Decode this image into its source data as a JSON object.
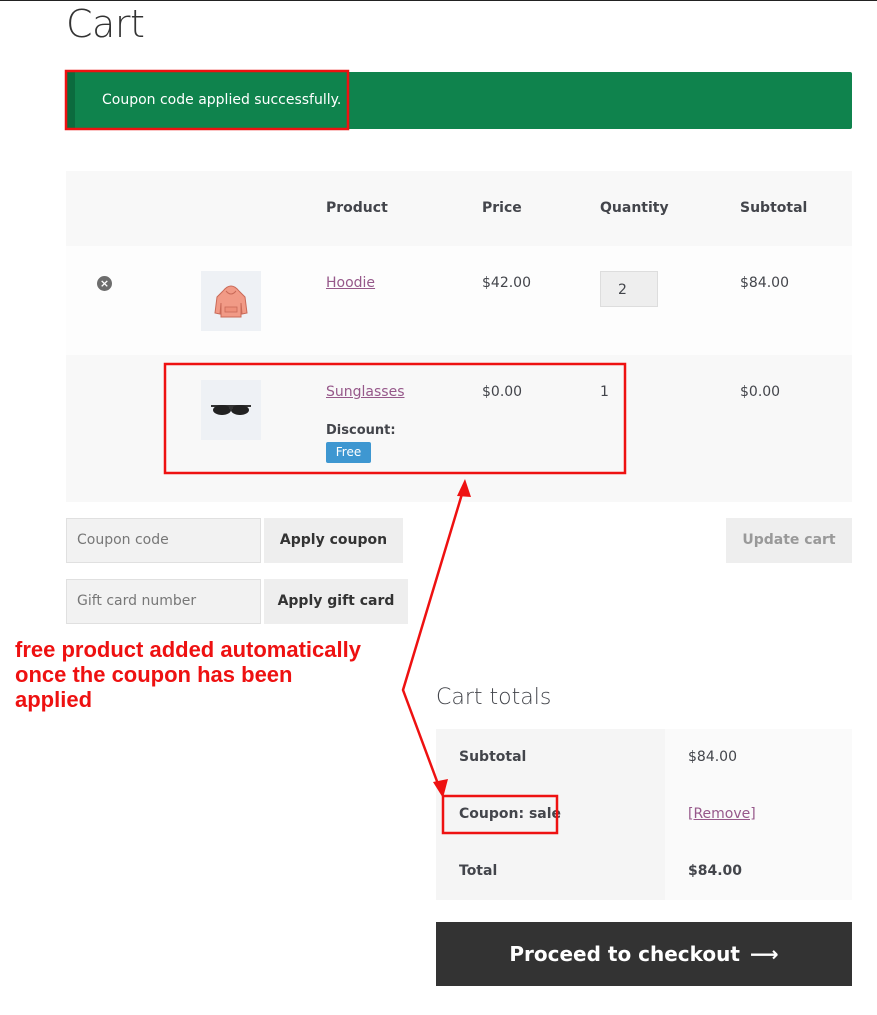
{
  "page_title": "Cart",
  "notice": {
    "text": "Coupon code applied successfully.",
    "color": "#0f834d"
  },
  "table": {
    "headers": {
      "product": "Product",
      "price": "Price",
      "quantity": "Quantity",
      "subtotal": "Subtotal"
    },
    "rows": [
      {
        "name": "Hoodie",
        "price": "$42.00",
        "quantity": "2",
        "subtotal": "$84.00",
        "thumb_icon": "hoodie-icon",
        "remove_icon": "remove-icon"
      },
      {
        "name": "Sunglasses",
        "price": "$0.00",
        "quantity": "1",
        "subtotal": "$0.00",
        "thumb_icon": "sunglasses-icon",
        "discount_label": "Discount:",
        "discount_badge": "Free"
      }
    ]
  },
  "actions": {
    "coupon_placeholder": "Coupon code",
    "apply_coupon": "Apply coupon",
    "gift_placeholder": "Gift card number",
    "apply_gift": "Apply gift card",
    "update_cart": "Update cart"
  },
  "annotation": {
    "line1": "free product added automatically",
    "line2": "once the coupon has been",
    "line3": "applied",
    "color": "#ee1111"
  },
  "totals": {
    "title": "Cart totals",
    "subtotal_label": "Subtotal",
    "subtotal_value": "$84.00",
    "coupon_label": "Coupon: sale",
    "coupon_remove": "[Remove]",
    "total_label": "Total",
    "total_value": "$84.00"
  },
  "checkout": {
    "label": "Proceed to checkout",
    "arrow_icon": "arrow-right-icon"
  },
  "colors": {
    "link": "#96588a",
    "badge": "#3e97d1",
    "checkout_bg": "#333333"
  }
}
